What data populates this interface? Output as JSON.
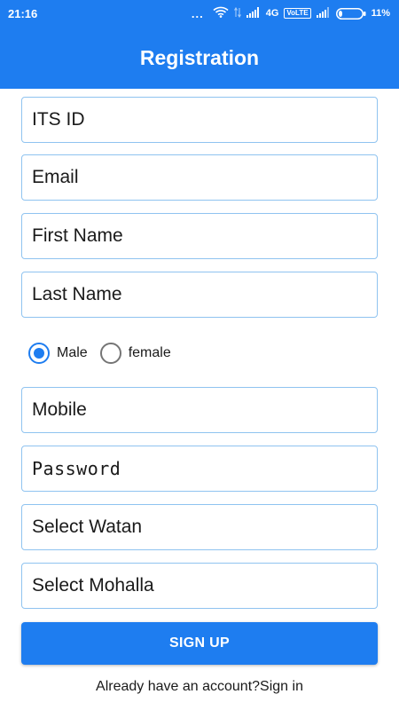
{
  "status_bar": {
    "time": "21:16",
    "overflow": "...",
    "network_type": "4G",
    "volte": "VoLTE",
    "battery_percent": "11%",
    "icons": [
      "wifi-icon",
      "data-arrows-icon",
      "signal-icon",
      "signal-icon",
      "battery-icon"
    ]
  },
  "app_bar": {
    "title": "Registration"
  },
  "form": {
    "its_id": {
      "placeholder": "ITS ID"
    },
    "email": {
      "placeholder": "Email"
    },
    "first_name": {
      "placeholder": "First Name"
    },
    "last_name": {
      "placeholder": "Last Name"
    },
    "gender": {
      "options": [
        {
          "label": "Male",
          "checked": true
        },
        {
          "label": "female",
          "checked": false
        }
      ]
    },
    "mobile": {
      "placeholder": "Mobile"
    },
    "password": {
      "placeholder": "Password"
    },
    "watan": {
      "value": "Select Watan"
    },
    "mohalla": {
      "value": "Select Mohalla"
    }
  },
  "actions": {
    "signup_label": "SIGN UP",
    "signin_text": "Already have an account?Sign in"
  },
  "colors": {
    "primary": "#1e7df0",
    "field_border": "#8fc3f0",
    "text": "#1a1a1a"
  }
}
